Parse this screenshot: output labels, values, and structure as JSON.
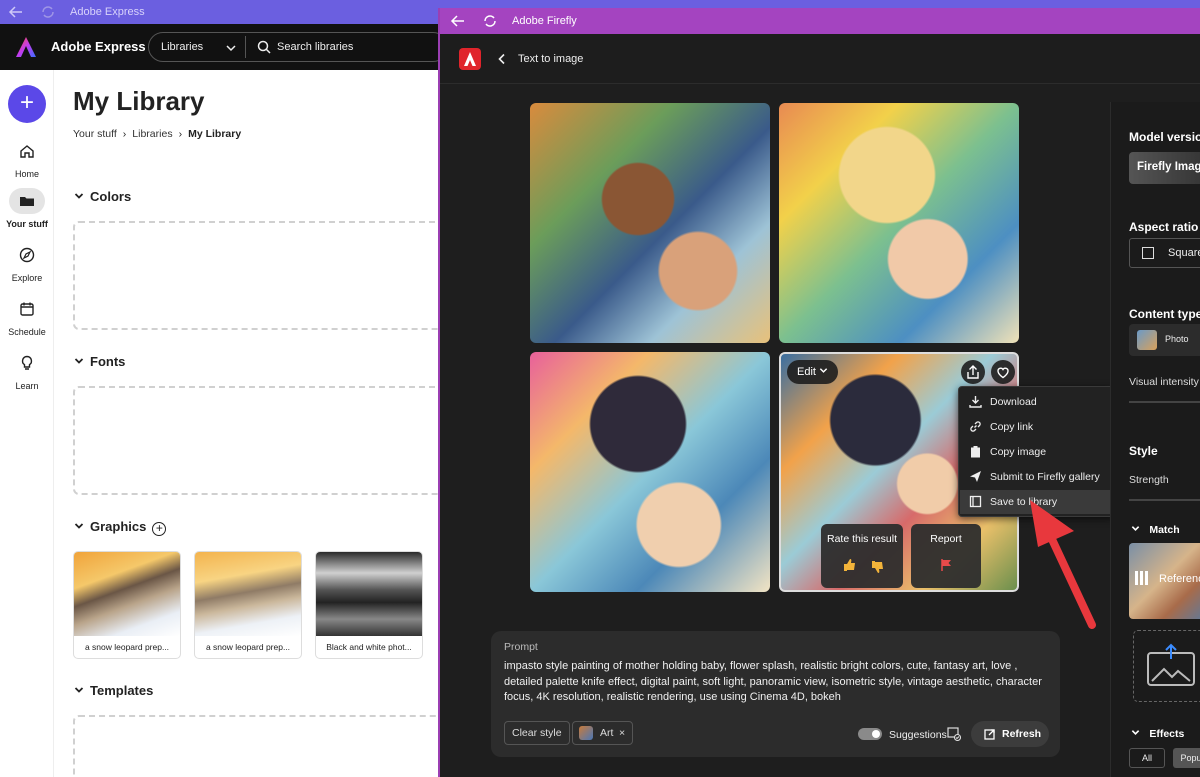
{
  "express": {
    "window_title": "Adobe Express",
    "app_name": "Adobe Express",
    "search": {
      "scope": "Libraries",
      "placeholder": "Search libraries"
    },
    "rail": [
      {
        "label": "Home",
        "icon": "home-icon"
      },
      {
        "label": "Your stuff",
        "icon": "folder-icon",
        "active": true
      },
      {
        "label": "Explore",
        "icon": "compass-icon"
      },
      {
        "label": "Schedule",
        "icon": "calendar-icon"
      },
      {
        "label": "Learn",
        "icon": "lightbulb-icon"
      }
    ],
    "page_title": "My Library",
    "breadcrumb": [
      "Your stuff",
      "Libraries",
      "My Library"
    ],
    "sections": {
      "colors": "Colors",
      "fonts": "Fonts",
      "graphics": "Graphics",
      "templates": "Templates"
    },
    "graphics_items": [
      "a snow leopard prep...",
      "a snow leopard prep...",
      "Black and white phot..."
    ]
  },
  "firefly": {
    "window_title": "Adobe Firefly",
    "page": "Text to image",
    "edit_label": "Edit",
    "rate_label": "Rate this result",
    "report_label": "Report",
    "menu": [
      "Download",
      "Copy link",
      "Copy image",
      "Submit to Firefly gallery",
      "Save to library"
    ],
    "menu_hover_index": 4,
    "prompt": {
      "label": "Prompt",
      "text": "impasto style painting of mother holding baby, flower splash, realistic bright colors, cute, fantasy art, love , detailed palette knife effect, digital paint, soft light, panoramic view, isometric style, vintage aesthetic, character focus, 4K resolution, realistic rendering, use using Cinema 4D, bokeh",
      "clear_style": "Clear style",
      "style_chip": "Art",
      "suggestions": "Suggestions",
      "refresh": "Refresh"
    },
    "panel": {
      "model_version": "Model version",
      "model_value": "Firefly Image",
      "aspect_ratio": "Aspect ratio",
      "aspect_value": "Square",
      "content_type": "Content type",
      "content_value": "Photo",
      "visual_intensity": "Visual intensity",
      "style": "Style",
      "strength": "Strength",
      "match": "Match",
      "reference": "Referenc",
      "effects": "Effects",
      "effect_tabs": [
        "All",
        "Popu"
      ]
    }
  },
  "colors": {
    "express_accent": "#5b48e8",
    "firefly_titlebar": "#a444c0",
    "arrow": "#e8383d"
  }
}
